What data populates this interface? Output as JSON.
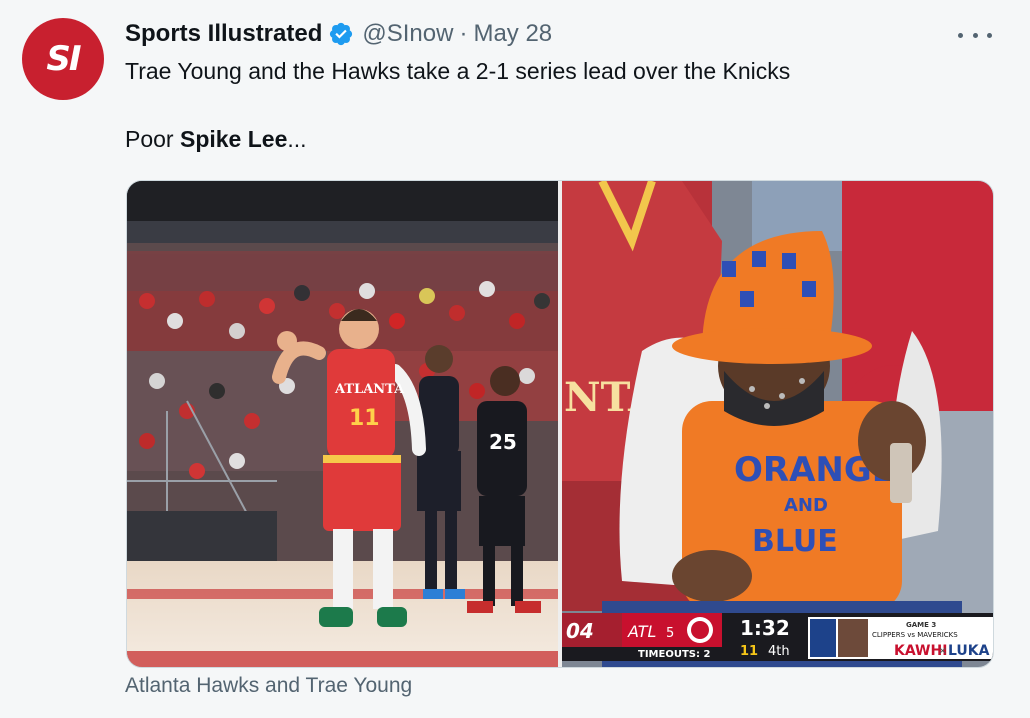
{
  "account": {
    "avatar_text": "SI",
    "name": "Sports Illustrated",
    "handle": "@SInow",
    "separator": "·",
    "date": "May 28",
    "brand_color": "#c8202f",
    "verified_color": "#1d9bf0"
  },
  "tweet": {
    "line1": "Trae Young and the Hawks take a 2-1 series lead over the Knicks",
    "line2_prefix": "Poor ",
    "line2_bold": "Spike Lee",
    "line2_suffix": "..."
  },
  "media": {
    "left_jersey_team": "ATLANTA",
    "left_jersey_number": "11",
    "left_opponent_number": "25",
    "right_shirt_word1": "ORANGE",
    "right_shirt_word2": "AND",
    "right_shirt_word3": "BLUE",
    "right_jersey_text": "NTA",
    "scorebug": {
      "away_score": "04",
      "home_team": "ATL",
      "home_fouls": "5",
      "timeouts": "TIMEOUTS: 2",
      "clock": "1:32",
      "shot_clock": "11",
      "period": "4th",
      "promo_game": "GAME 3",
      "promo_teams": "CLIPPERS vs MAVERICKS",
      "promo_player1": "KAWHI",
      "promo_x": "×",
      "promo_player2": "LUKA"
    }
  },
  "caption": "Atlanta Hawks and Trae Young",
  "icons": [
    "verified-badge-icon",
    "more-options-icon"
  ]
}
